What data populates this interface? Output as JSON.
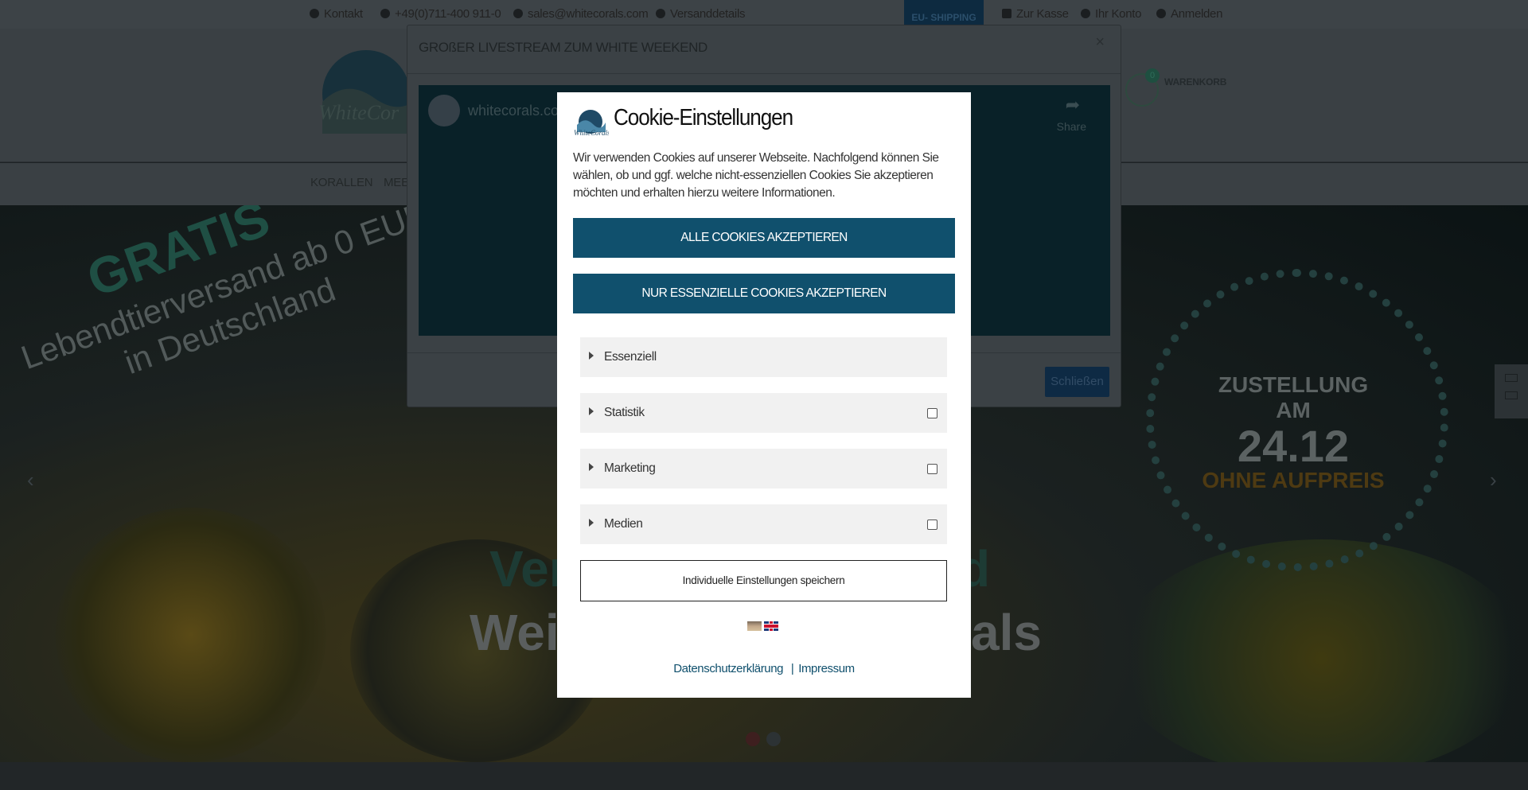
{
  "topbar": {
    "contact": "Kontakt",
    "phone": "+49(0)711-400 911-0",
    "email": "sales@whitecorals.com",
    "shipping_details": "Versanddetails",
    "eu_shipping": "EU- SHIPPING",
    "checkout": "Zur Kasse",
    "account": "Ihr Konto",
    "login": "Anmelden"
  },
  "header": {
    "cart_count": "0",
    "cart_label": "WARENKORB"
  },
  "nav": {
    "items": [
      "KORALLEN",
      "MEE"
    ]
  },
  "hero": {
    "gratis": "GRATIS",
    "gratis_sub_1": "Lebendtierversand ab 0 EUR",
    "gratis_sub_2": "in Deutschland",
    "star_line_1": "ZUSTELLUNG",
    "star_line_2": "AM",
    "star_date": "24.12",
    "star_line_3": "OHNE AUFPREIS",
    "headline_1": "Vers",
    "headline_2": "Weih",
    "headline_2_end": "als",
    "headline_1_end": "d"
  },
  "livestream": {
    "title": "GROßER LIVESTREAM ZUM WHITE WEEKEND",
    "close": "×",
    "channel": "whitecorals.co",
    "share": "Share",
    "close_button": "Schließen"
  },
  "cookie": {
    "title": "Cookie-Einstellungen",
    "text": "Wir verwenden Cookies auf unserer Webseite. Nachfolgend können Sie wählen, ob und ggf. welche nicht-essenziellen Cookies Sie akzeptieren möchten und erhalten hierzu weitere Informationen.",
    "accept_all": "ALLE COOKIES AKZEPTIEREN",
    "accept_essential": "NUR ESSENZIELLE COOKIES AKZEPTIEREN",
    "categories": [
      {
        "label": "Essenziell",
        "checkbox": false
      },
      {
        "label": "Statistik",
        "checkbox": true
      },
      {
        "label": "Marketing",
        "checkbox": true
      },
      {
        "label": "Medien",
        "checkbox": true
      }
    ],
    "save_individual": "Individuelle Einstellungen speichern",
    "privacy_link": "Datenschutzerklärung",
    "separator": "|",
    "imprint_link": "Impressum",
    "accent_color": "#10506d"
  }
}
